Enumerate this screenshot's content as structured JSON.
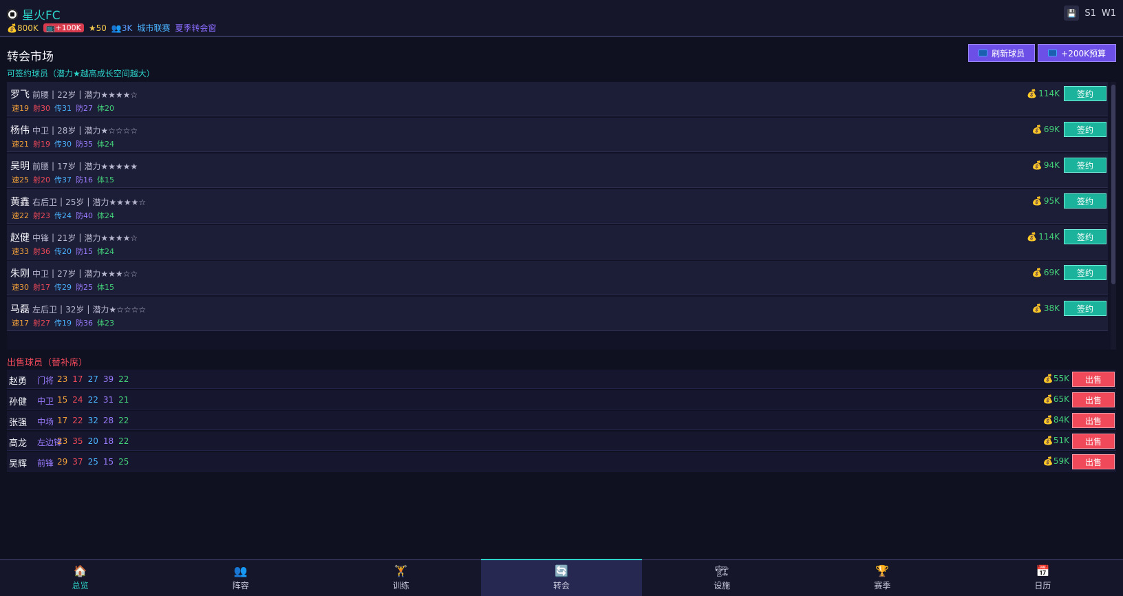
{
  "header": {
    "club_name": "星火FC",
    "money": "800K",
    "ad_badge": "+100K",
    "stars": "50",
    "fans": "3K",
    "league": "城市联赛",
    "window": "夏季转会窗",
    "season": "S1",
    "week": "W1"
  },
  "market": {
    "title": "转会市场",
    "refresh_label": "刷新球员",
    "budget_label": "+200K预算",
    "subtitle": "可签约球员（潜力★越高成长空间越大）",
    "sign_label": "签约",
    "players": [
      {
        "name": "罗飞",
        "pos": "前腰",
        "age": "22岁",
        "potential": "潜力★★★★☆",
        "spd": "速19",
        "sht": "射30",
        "pas": "传31",
        "def": "防27",
        "sta": "体20",
        "price": "114K"
      },
      {
        "name": "杨伟",
        "pos": "中卫",
        "age": "28岁",
        "potential": "潜力★☆☆☆☆",
        "spd": "速21",
        "sht": "射19",
        "pas": "传30",
        "def": "防35",
        "sta": "体24",
        "price": "69K"
      },
      {
        "name": "吴明",
        "pos": "前腰",
        "age": "17岁",
        "potential": "潜力★★★★★",
        "spd": "速25",
        "sht": "射20",
        "pas": "传37",
        "def": "防16",
        "sta": "体15",
        "price": "94K"
      },
      {
        "name": "黄鑫",
        "pos": "右后卫",
        "age": "25岁",
        "potential": "潜力★★★★☆",
        "spd": "速22",
        "sht": "射23",
        "pas": "传24",
        "def": "防40",
        "sta": "体24",
        "price": "95K"
      },
      {
        "name": "赵健",
        "pos": "中锋",
        "age": "21岁",
        "potential": "潜力★★★★☆",
        "spd": "速33",
        "sht": "射36",
        "pas": "传20",
        "def": "防15",
        "sta": "体24",
        "price": "114K"
      },
      {
        "name": "朱刚",
        "pos": "中卫",
        "age": "27岁",
        "potential": "潜力★★★☆☆",
        "spd": "速30",
        "sht": "射17",
        "pas": "传29",
        "def": "防25",
        "sta": "体15",
        "price": "69K"
      },
      {
        "name": "马磊",
        "pos": "左后卫",
        "age": "32岁",
        "potential": "潜力★☆☆☆☆",
        "spd": "速17",
        "sht": "射27",
        "pas": "传19",
        "def": "防36",
        "sta": "体23",
        "price": "38K"
      }
    ]
  },
  "sell": {
    "title": "出售球员（替补席）",
    "sell_label": "出售",
    "players": [
      {
        "name": "赵勇",
        "pos": "门将",
        "stats": [
          "23",
          "17",
          "27",
          "39",
          "22"
        ],
        "price": "55K"
      },
      {
        "name": "孙健",
        "pos": "中卫",
        "stats": [
          "15",
          "24",
          "22",
          "31",
          "21"
        ],
        "price": "65K"
      },
      {
        "name": "张强",
        "pos": "中场",
        "stats": [
          "17",
          "22",
          "32",
          "28",
          "22"
        ],
        "price": "84K"
      },
      {
        "name": "高龙",
        "pos": "左边锋",
        "stats": [
          "23",
          "35",
          "20",
          "18",
          "22"
        ],
        "price": "51K"
      },
      {
        "name": "吴辉",
        "pos": "前锋",
        "stats": [
          "29",
          "37",
          "25",
          "15",
          "25"
        ],
        "price": "59K"
      }
    ]
  },
  "nav": [
    {
      "label": "总览",
      "icon": "home-icon"
    },
    {
      "label": "阵容",
      "icon": "users-icon"
    },
    {
      "label": "训练",
      "icon": "training-icon"
    },
    {
      "label": "转会",
      "icon": "transfer-icon"
    },
    {
      "label": "设施",
      "icon": "facility-icon"
    },
    {
      "label": "赛季",
      "icon": "trophy-icon"
    },
    {
      "label": "日历",
      "icon": "calendar-icon"
    }
  ],
  "active_nav": "转会"
}
